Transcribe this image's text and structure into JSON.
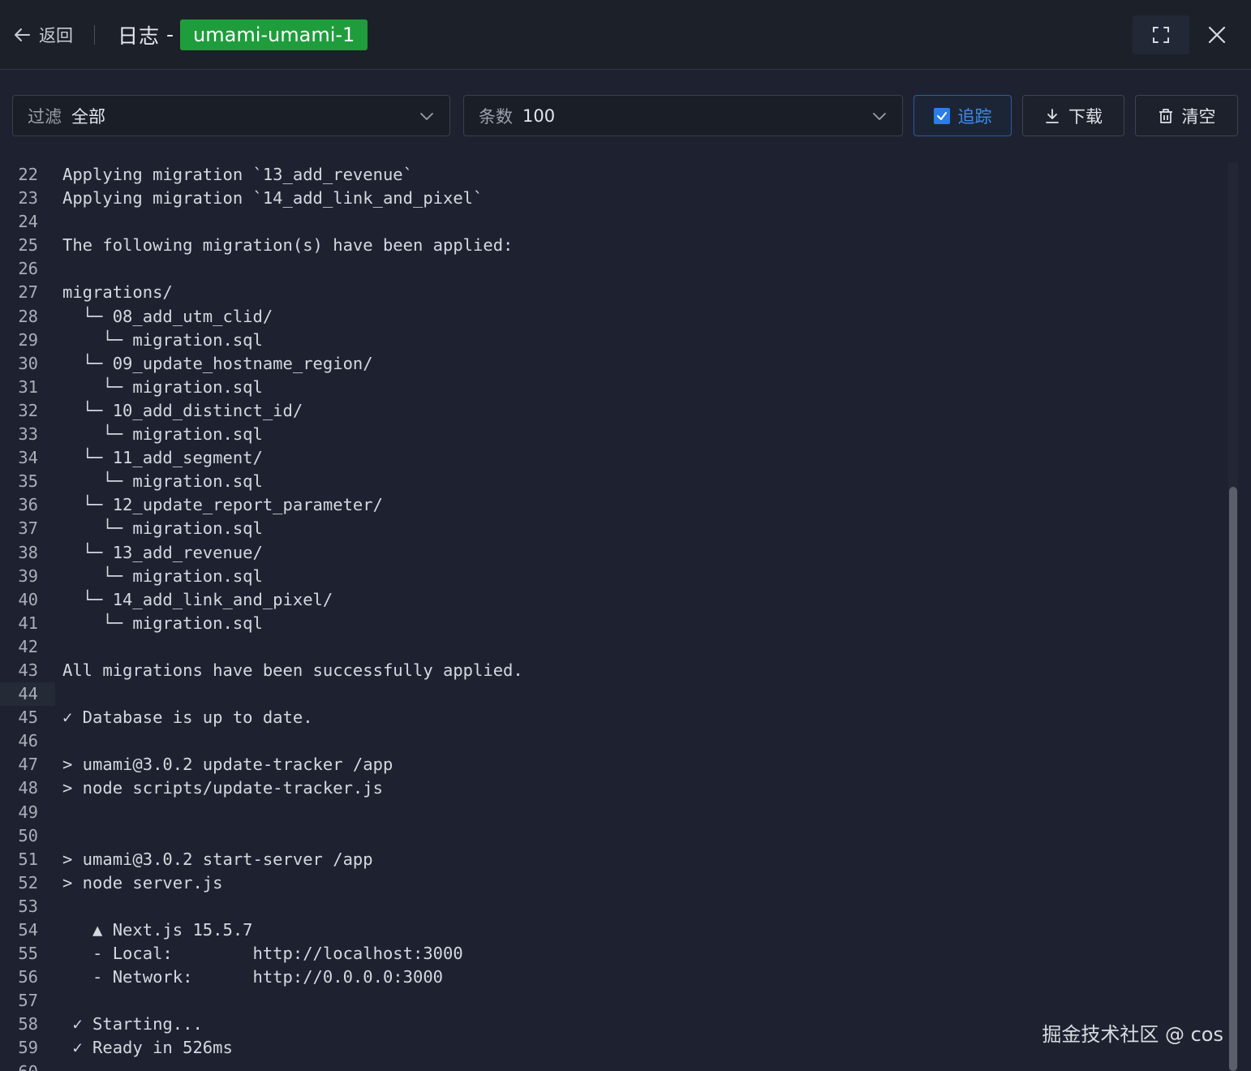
{
  "header": {
    "back_label": "返回",
    "title": "日志",
    "title_dash": "-",
    "container_name": "umami-umami-1"
  },
  "toolbar": {
    "filter": {
      "label": "过滤",
      "value": "全部"
    },
    "count": {
      "label": "条数",
      "value": "100"
    },
    "follow_label": "追踪",
    "follow_checked": true,
    "download_label": "下载",
    "clear_label": "清空"
  },
  "log": {
    "lines": [
      {
        "n": "22",
        "text": "Applying migration `13_add_revenue`"
      },
      {
        "n": "23",
        "text": "Applying migration `14_add_link_and_pixel`"
      },
      {
        "n": "24",
        "text": ""
      },
      {
        "n": "25",
        "text": "The following migration(s) have been applied:"
      },
      {
        "n": "26",
        "text": ""
      },
      {
        "n": "27",
        "text": "migrations/"
      },
      {
        "n": "28",
        "text": "  └─ 08_add_utm_clid/"
      },
      {
        "n": "29",
        "text": "    └─ migration.sql"
      },
      {
        "n": "30",
        "text": "  └─ 09_update_hostname_region/"
      },
      {
        "n": "31",
        "text": "    └─ migration.sql"
      },
      {
        "n": "32",
        "text": "  └─ 10_add_distinct_id/"
      },
      {
        "n": "33",
        "text": "    └─ migration.sql"
      },
      {
        "n": "34",
        "text": "  └─ 11_add_segment/"
      },
      {
        "n": "35",
        "text": "    └─ migration.sql"
      },
      {
        "n": "36",
        "text": "  └─ 12_update_report_parameter/"
      },
      {
        "n": "37",
        "text": "    └─ migration.sql"
      },
      {
        "n": "38",
        "text": "  └─ 13_add_revenue/"
      },
      {
        "n": "39",
        "text": "    └─ migration.sql"
      },
      {
        "n": "40",
        "text": "  └─ 14_add_link_and_pixel/"
      },
      {
        "n": "41",
        "text": "    └─ migration.sql"
      },
      {
        "n": "42",
        "text": ""
      },
      {
        "n": "43",
        "text": "All migrations have been successfully applied."
      },
      {
        "n": "44",
        "text": ""
      },
      {
        "n": "45",
        "text": "✓ Database is up to date."
      },
      {
        "n": "46",
        "text": ""
      },
      {
        "n": "47",
        "text": "> umami@3.0.2 update-tracker /app"
      },
      {
        "n": "48",
        "text": "> node scripts/update-tracker.js"
      },
      {
        "n": "49",
        "text": ""
      },
      {
        "n": "50",
        "text": ""
      },
      {
        "n": "51",
        "text": "> umami@3.0.2 start-server /app"
      },
      {
        "n": "52",
        "text": "> node server.js"
      },
      {
        "n": "53",
        "text": ""
      },
      {
        "n": "54",
        "text": "   ▲ Next.js 15.5.7"
      },
      {
        "n": "55",
        "text": "   - Local:        http://localhost:3000"
      },
      {
        "n": "56",
        "text": "   - Network:      http://0.0.0.0:3000"
      },
      {
        "n": "57",
        "text": ""
      },
      {
        "n": "58",
        "text": " ✓ Starting..."
      },
      {
        "n": "59",
        "text": " ✓ Ready in 526ms"
      },
      {
        "n": "60",
        "text": ""
      }
    ],
    "highlighted_line": "44"
  },
  "watermark": "掘金技术社区 @ cos",
  "colors": {
    "background": "#1e2230",
    "badge": "#1f9d3c",
    "accent": "#2b7de9"
  }
}
